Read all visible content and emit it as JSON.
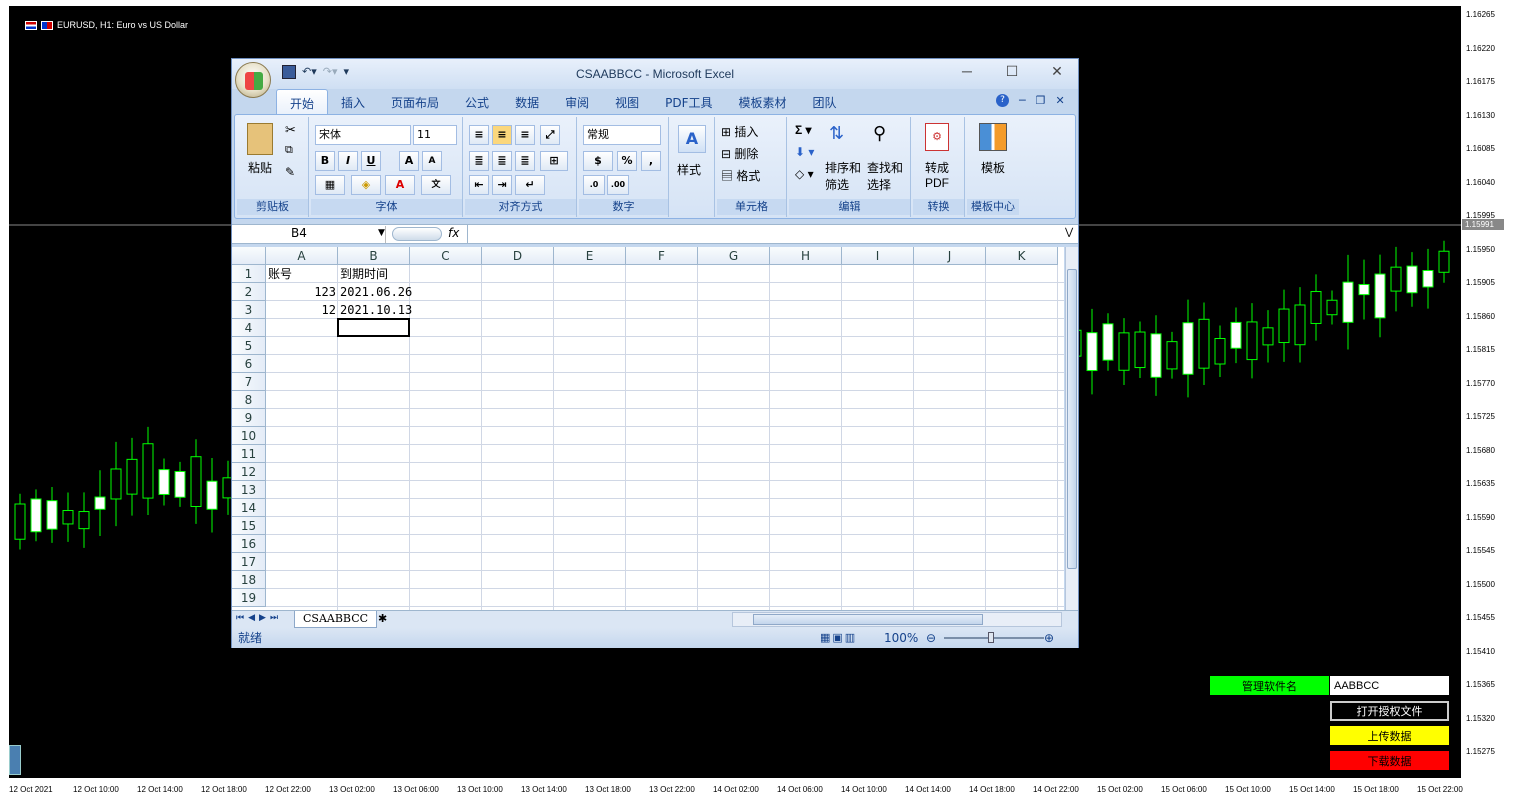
{
  "chart_window": {
    "symbol": "EURUSD, H1:  Euro vs US Dollar",
    "price_labels": [
      "1.16265",
      "1.16220",
      "1.16175",
      "1.16130",
      "1.16085",
      "1.16040",
      "1.15995",
      "1.15950",
      "1.15905",
      "1.15860",
      "1.15815",
      "1.15770",
      "1.15725",
      "1.15680",
      "1.15635",
      "1.15590",
      "1.15545",
      "1.15500",
      "1.15455",
      "1.15410",
      "1.15365",
      "1.15320",
      "1.15275"
    ],
    "current_price": "1.15991",
    "time_labels": [
      "12 Oct 2021",
      "12 Oct 10:00",
      "12 Oct 14:00",
      "12 Oct 18:00",
      "12 Oct 22:00",
      "13 Oct 02:00",
      "13 Oct 06:00",
      "13 Oct 10:00",
      "13 Oct 14:00",
      "13 Oct 18:00",
      "13 Oct 22:00",
      "14 Oct 02:00",
      "14 Oct 06:00",
      "14 Oct 10:00",
      "14 Oct 14:00",
      "14 Oct 18:00",
      "14 Oct 22:00",
      "15 Oct 02:00",
      "15 Oct 06:00",
      "15 Oct 10:00",
      "15 Oct 14:00",
      "15 Oct 18:00",
      "15 Oct 22:00"
    ],
    "colors": {
      "bg": "#000000",
      "candle": "#00ff00",
      "bull_body": "#000000",
      "bear_body": "#ffffff"
    }
  },
  "panel": {
    "name_label": "管理软件名",
    "name_value": "AABBCC",
    "open_license": "打开授权文件",
    "upload": "上传数据",
    "download": "下载数据"
  },
  "excel": {
    "title": "CSAABBCC - Microsoft Excel",
    "tabs": [
      "开始",
      "插入",
      "页面布局",
      "公式",
      "数据",
      "审阅",
      "视图",
      "PDF工具",
      "模板素材",
      "团队"
    ],
    "ribbon": {
      "paste": "粘贴",
      "clipboard": "剪贴板",
      "font_name": "宋体",
      "font_size": "11",
      "font_group": "字体",
      "align_group": "对齐方式",
      "number_format": "常规",
      "number_group": "数字",
      "style": "样式",
      "insert": "插入",
      "delete": "删除",
      "format": "格式",
      "cells_group": "单元格",
      "sort_filter_1": "排序和",
      "sort_filter_2": "筛选",
      "find_select_1": "查找和",
      "find_select_2": "选择",
      "edit_group": "编辑",
      "to_pdf_1": "转成",
      "to_pdf_2": "PDF",
      "convert_group": "转换",
      "template": "模板",
      "template_group": "模板中心"
    },
    "name_box": "B4",
    "fx": "fx",
    "columns": [
      "A",
      "B",
      "C",
      "D",
      "E",
      "F",
      "G",
      "H",
      "I",
      "J",
      "K"
    ],
    "rows": [
      "1",
      "2",
      "3",
      "4",
      "5",
      "6",
      "7",
      "8",
      "9",
      "10",
      "11",
      "12",
      "13",
      "14",
      "15",
      "16",
      "17",
      "18",
      "19"
    ],
    "cells": {
      "A1": "账号",
      "B1": "到期时间",
      "A2": "123",
      "B2": "2021.06.26",
      "A3": "12",
      "B3": "2021.10.13"
    },
    "sheet": "CSAABBCC",
    "status": "就绪",
    "zoom": "100%"
  }
}
